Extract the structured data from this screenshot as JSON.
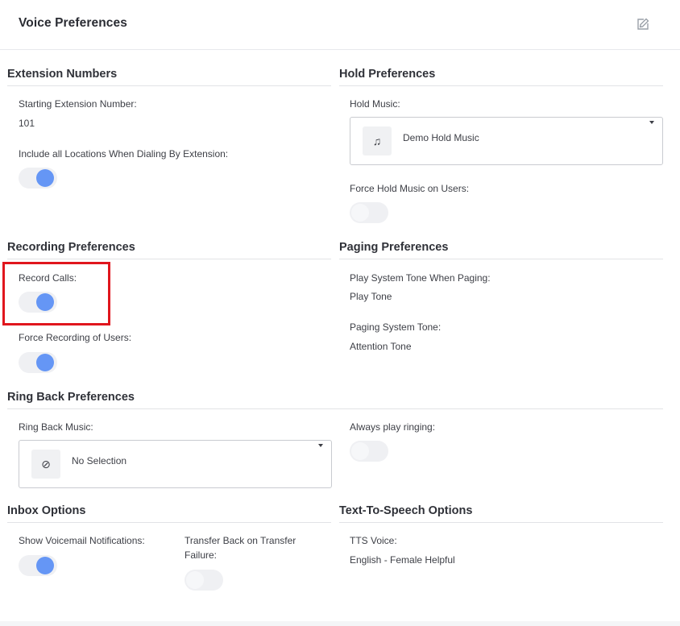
{
  "header": {
    "title": "Voice Preferences",
    "edit_icon": "edit-icon"
  },
  "extension": {
    "title": "Extension Numbers",
    "start_label": "Starting Extension Number:",
    "start_value": "101",
    "include_label": "Include all Locations When Dialing By Extension:",
    "include_on": true
  },
  "hold": {
    "title": "Hold Preferences",
    "music_label": "Hold Music:",
    "music_value": "Demo Hold Music",
    "music_icon": "music-note-icon",
    "force_label": "Force Hold Music on Users:",
    "force_on": false
  },
  "recording": {
    "title": "Recording Preferences",
    "record_label": "Record Calls:",
    "record_on": true,
    "force_label": "Force Recording of Users:",
    "force_on": true
  },
  "paging": {
    "title": "Paging Preferences",
    "play_label": "Play System Tone When Paging:",
    "play_value": "Play Tone",
    "tone_label": "Paging System Tone:",
    "tone_value": "Attention Tone"
  },
  "ringback": {
    "title": "Ring Back Preferences",
    "music_label": "Ring Back Music:",
    "music_value": "No Selection",
    "music_icon": "no-selection-icon",
    "always_label": "Always play ringing:",
    "always_on": false
  },
  "inbox": {
    "title": "Inbox Options",
    "voicemail_label": "Show Voicemail Notifications:",
    "voicemail_on": true,
    "transfer_label_1": "Transfer Back on Transfer",
    "transfer_label_2": "Failure:",
    "transfer_on": false
  },
  "tts": {
    "title": "Text-To-Speech Options",
    "voice_label": "TTS Voice:",
    "voice_value": "English - Female Helpful"
  },
  "colors": {
    "accent": "#6596f5",
    "highlight": "#e0161d"
  }
}
